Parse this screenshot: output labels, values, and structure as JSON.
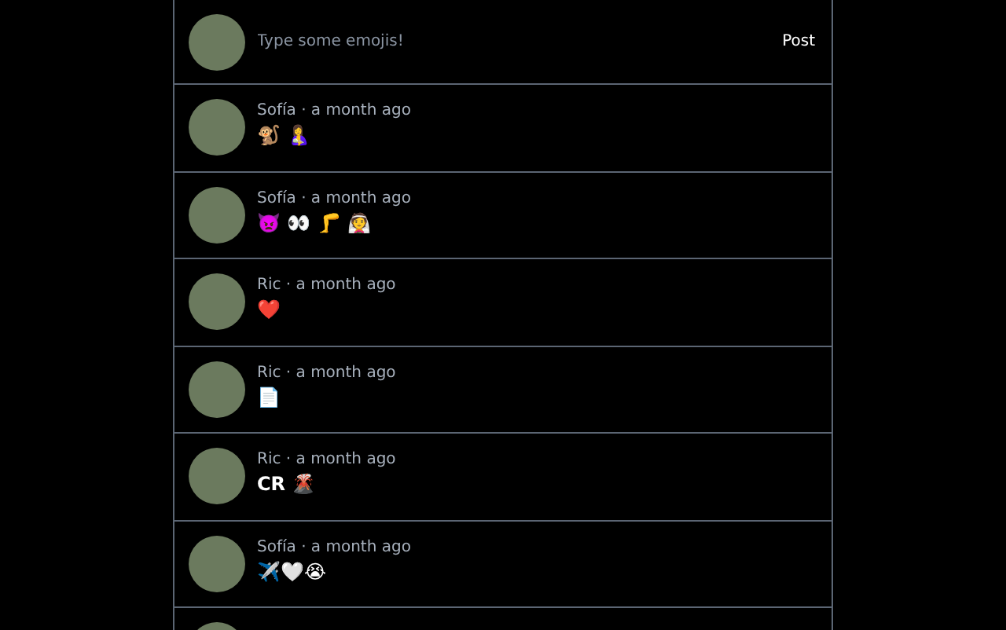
{
  "composer": {
    "placeholder": "Type some emojis!",
    "button": "Post"
  },
  "posts": [
    {
      "byline": "Sofía · a month ago",
      "content": "🐒 🤱"
    },
    {
      "byline": "Sofía · a month ago",
      "content": "👿 👀 🦵 👰"
    },
    {
      "byline": "Ric · a month ago",
      "content": "❤️"
    },
    {
      "byline": "Ric · a month ago",
      "content": "📄"
    },
    {
      "byline": "Ric · a month ago",
      "content": "CR 🌋"
    },
    {
      "byline": "Sofía · a month ago",
      "content": "✈️🤍😭"
    }
  ]
}
